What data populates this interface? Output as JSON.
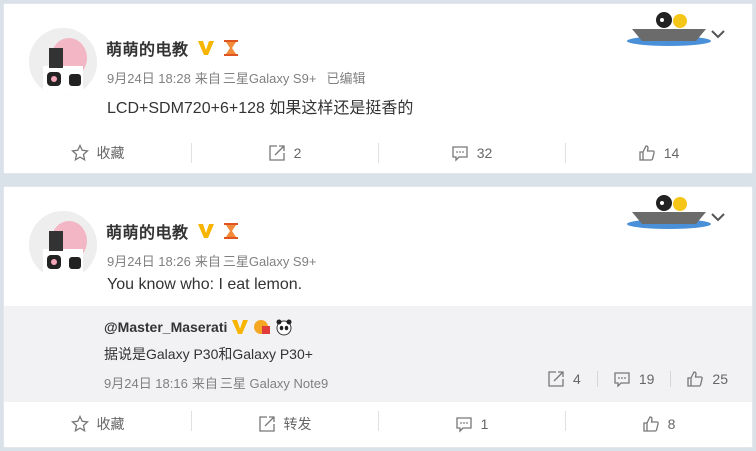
{
  "posts": [
    {
      "author": "萌萌的电教",
      "date": "9月24日 18:28",
      "source_prefix": "来自",
      "source": "三星Galaxy S9+",
      "edited": "已编辑",
      "text": "LCD+SDM720+6+128 如果这样还是挺香的",
      "actions": {
        "favorite": "收藏",
        "repost": "2",
        "comment": "32",
        "like": "14"
      }
    },
    {
      "author": "萌萌的电教",
      "date": "9月24日 18:26",
      "source_prefix": "来自",
      "source": "三星Galaxy S9+",
      "text": "You know who: I eat lemon.",
      "repost": {
        "author": "@Master_Maserati",
        "text": "据说是Galaxy P30和Galaxy P30+",
        "date": "9月24日 18:16",
        "source_prefix": "来自",
        "source": "三星 Galaxy Note9",
        "stats": {
          "repost": "4",
          "comment": "19",
          "like": "25"
        }
      },
      "actions": {
        "favorite": "收藏",
        "repost": "转发",
        "comment": "1",
        "like": "8"
      }
    }
  ],
  "colors": {
    "verified": "#f7b500",
    "page_bg": "#d9e2e9",
    "repost_bg": "#f2f2f5"
  },
  "icons": {
    "star": "star-icon",
    "repost": "repost-icon",
    "comment": "comment-icon",
    "like": "thumb-up-icon",
    "chevron": "chevron-down-icon"
  }
}
